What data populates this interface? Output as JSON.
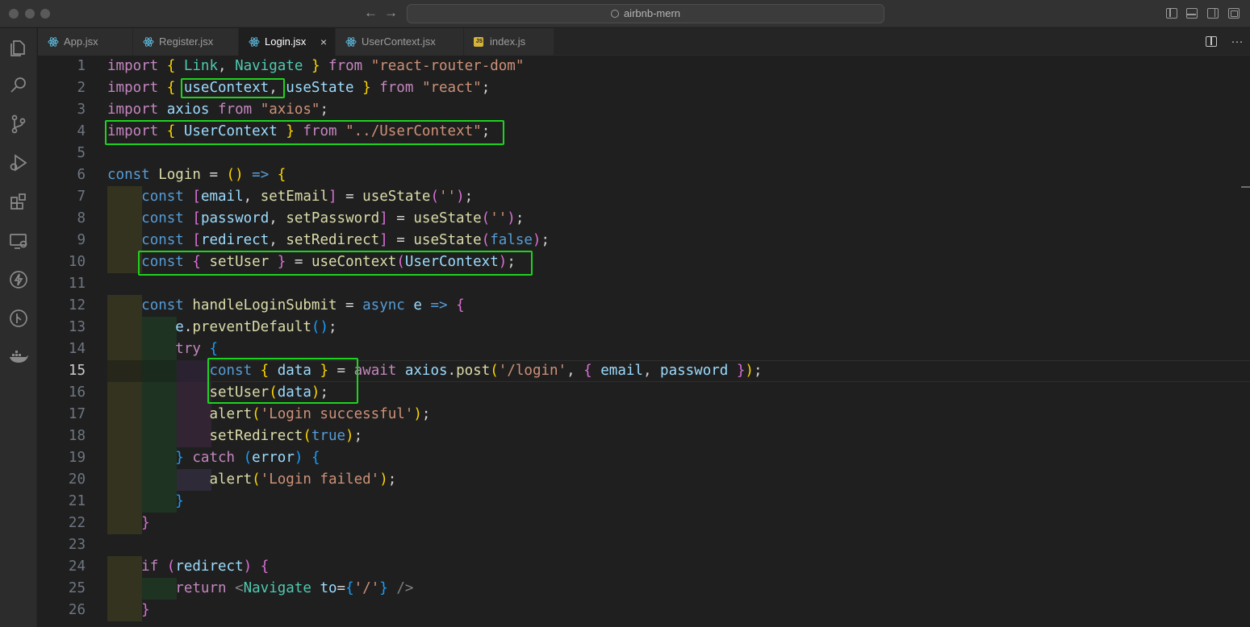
{
  "window": {
    "search_text": "airbnb-mern"
  },
  "activity_bar": {
    "icons": [
      "explorer-icon",
      "search-icon",
      "source-control-icon",
      "run-debug-icon",
      "extensions-icon",
      "remote-explorer-icon",
      "thunder-client-icon",
      "git-graph-icon",
      "docker-icon"
    ]
  },
  "tabs": [
    {
      "label": "App.jsx",
      "icon": "react-icon",
      "active": false
    },
    {
      "label": "Register.jsx",
      "icon": "react-icon",
      "active": false
    },
    {
      "label": "Login.jsx",
      "icon": "react-icon",
      "active": true
    },
    {
      "label": "UserContext.jsx",
      "icon": "react-icon",
      "active": false
    },
    {
      "label": "index.js",
      "icon": "js-icon",
      "active": false
    }
  ],
  "tab_close_glyph": "×",
  "more_actions_glyph": "···",
  "js_badge_text": "JS",
  "editor": {
    "current_line": 15,
    "highlighted_lines": [
      2,
      4,
      10,
      15,
      16
    ],
    "lines": [
      {
        "n": "1",
        "text": "import { Link, Navigate } from \"react-router-dom\""
      },
      {
        "n": "2",
        "text": "import { useContext, useState } from \"react\";"
      },
      {
        "n": "3",
        "text": "import axios from \"axios\";"
      },
      {
        "n": "4",
        "text": "import { UserContext } from \"../UserContext\";"
      },
      {
        "n": "5",
        "text": ""
      },
      {
        "n": "6",
        "text": "const Login = () => {"
      },
      {
        "n": "7",
        "text": "    const [email, setEmail] = useState('');"
      },
      {
        "n": "8",
        "text": "    const [password, setPassword] = useState('');"
      },
      {
        "n": "9",
        "text": "    const [redirect, setRedirect] = useState(false);"
      },
      {
        "n": "10",
        "text": "    const { setUser } = useContext(UserContext);"
      },
      {
        "n": "11",
        "text": ""
      },
      {
        "n": "12",
        "text": "    const handleLoginSubmit = async e => {"
      },
      {
        "n": "13",
        "text": "        e.preventDefault();"
      },
      {
        "n": "14",
        "text": "        try {"
      },
      {
        "n": "15",
        "text": "            const { data } = await axios.post('/login', { email, password });"
      },
      {
        "n": "16",
        "text": "            setUser(data);"
      },
      {
        "n": "17",
        "text": "            alert('Login successful');"
      },
      {
        "n": "18",
        "text": "            setRedirect(true);"
      },
      {
        "n": "19",
        "text": "        } catch (error) {"
      },
      {
        "n": "20",
        "text": "            alert('Login failed');"
      },
      {
        "n": "21",
        "text": "        }"
      },
      {
        "n": "22",
        "text": "    }"
      },
      {
        "n": "23",
        "text": ""
      },
      {
        "n": "24",
        "text": "    if (redirect) {"
      },
      {
        "n": "25",
        "text": "        return <Navigate to={'/'} />"
      },
      {
        "n": "26",
        "text": "    }"
      }
    ]
  },
  "colors": {
    "editor_background": "#1f1f1f",
    "highlight_box": "#1ed31e",
    "keyword": "#c586c0",
    "storage": "#569cd6",
    "function": "#dcdcaa",
    "variable": "#9cdcfe",
    "type": "#4ec9b0",
    "string": "#ce9178"
  }
}
